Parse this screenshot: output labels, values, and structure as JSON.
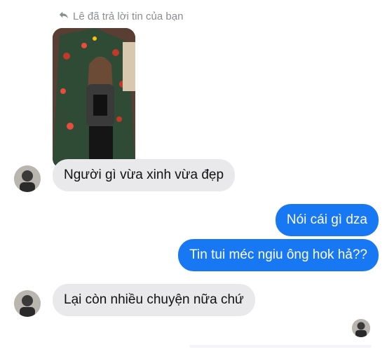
{
  "reply_indicator": {
    "icon": "reply-arrow-icon",
    "text": "Lê đã trả lời tin của bạn"
  },
  "quoted_photo": {
    "description_icon": "photo-icon"
  },
  "messages": [
    {
      "side": "in",
      "text": "Người gì vừa xinh vừa đẹp"
    },
    {
      "side": "out",
      "text": "Nói cái gì dza"
    },
    {
      "side": "out",
      "text": "Tin tui méc ngiu ông hok hả??"
    },
    {
      "side": "in",
      "text": "Lại còn nhiều chuyện nữa chứ"
    }
  ],
  "colors": {
    "outgoing_bubble": "#1877f2",
    "incoming_bubble": "#e9e9eb",
    "meta_text": "#8a8d91"
  }
}
